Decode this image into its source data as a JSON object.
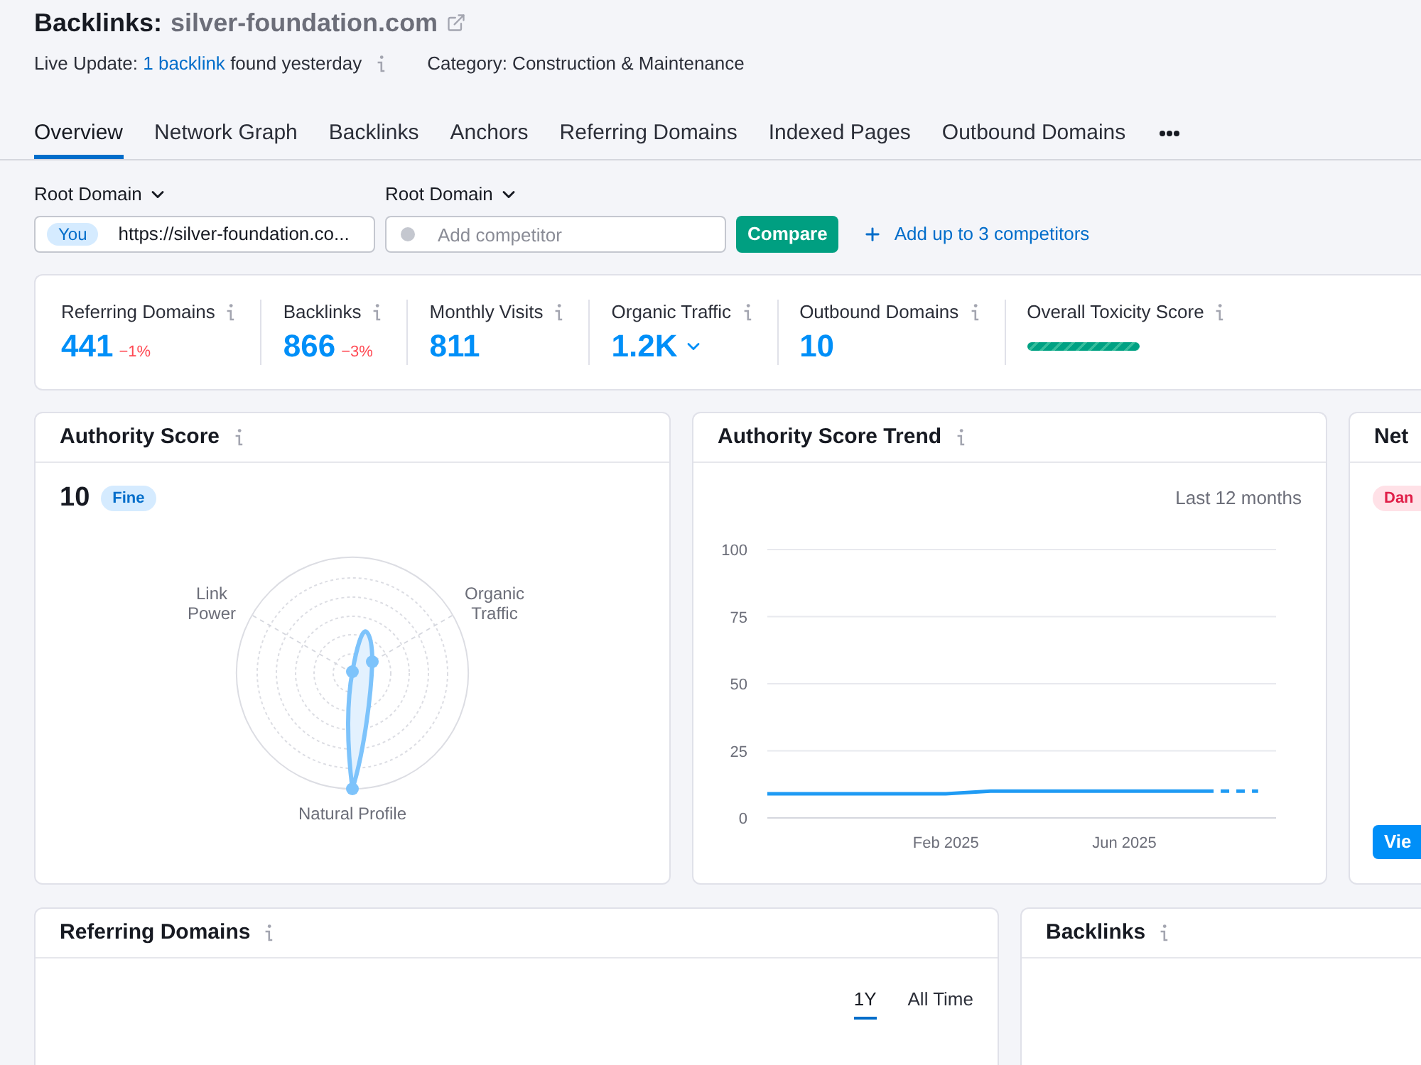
{
  "header": {
    "title": "Backlinks:",
    "domain": "silver-foundation.com",
    "live_update": {
      "prefix": "Live Update:",
      "link": "1 backlink",
      "suffix": "found yesterday"
    },
    "category": "Category: Construction & Maintenance"
  },
  "tabs": [
    {
      "label": "Overview",
      "selected": true
    },
    {
      "label": "Network Graph",
      "selected": false
    },
    {
      "label": "Backlinks",
      "selected": false
    },
    {
      "label": "Anchors",
      "selected": false
    },
    {
      "label": "Referring Domains",
      "selected": false
    },
    {
      "label": "Indexed Pages",
      "selected": false
    },
    {
      "label": "Outbound Domains",
      "selected": false
    }
  ],
  "compare": {
    "selectors": [
      {
        "label": "Root Domain"
      },
      {
        "label": "Root Domain"
      }
    ],
    "your_domain": {
      "tag": "You",
      "value": "https://silver-foundation.co..."
    },
    "competitor": {
      "placeholder": "Add competitor"
    },
    "button": "Compare",
    "add_link": "Add up to 3 competitors"
  },
  "metrics": [
    {
      "kind": "value",
      "label": "Referring Domains",
      "value": "441",
      "change": "−1%"
    },
    {
      "kind": "value",
      "label": "Backlinks",
      "value": "866",
      "change": "−3%"
    },
    {
      "kind": "value",
      "label": "Monthly Visits",
      "value": "811"
    },
    {
      "kind": "dropdown",
      "label": "Organic Traffic",
      "value": "1.2K"
    },
    {
      "kind": "value",
      "label": "Outbound Domains",
      "value": "10"
    },
    {
      "kind": "meter",
      "label": "Overall Toxicity Score"
    }
  ],
  "authority_score": {
    "title": "Authority Score",
    "score": "10",
    "badge": "Fine",
    "radar_labels": [
      "Link Power",
      "Organic Traffic",
      "Natural Profile"
    ]
  },
  "trend": {
    "title": "Authority Score Trend",
    "period": "Last 12 months",
    "chart_data": {
      "type": "line",
      "categories": [
        null,
        null,
        null,
        null,
        "Feb 2025",
        null,
        null,
        null,
        "Jun 2025",
        null,
        null,
        null
      ],
      "series": [
        {
          "color": "#1f9bf4",
          "line_style": "dashed_end",
          "values": [
            9,
            9,
            9,
            9,
            9,
            10,
            10,
            10,
            10,
            10,
            10,
            10
          ]
        }
      ],
      "ylim": [
        0,
        100
      ],
      "yticks": [
        0,
        25,
        50,
        75,
        100
      ],
      "grid": true
    }
  },
  "network": {
    "title": "Net",
    "badge": "Dan",
    "button": "Vie"
  },
  "referring_domains": {
    "title": "Referring Domains",
    "ranges": [
      {
        "label": "1Y",
        "selected": true
      },
      {
        "label": "All Time",
        "selected": false
      }
    ]
  },
  "backlinks": {
    "title": "Backlinks"
  }
}
